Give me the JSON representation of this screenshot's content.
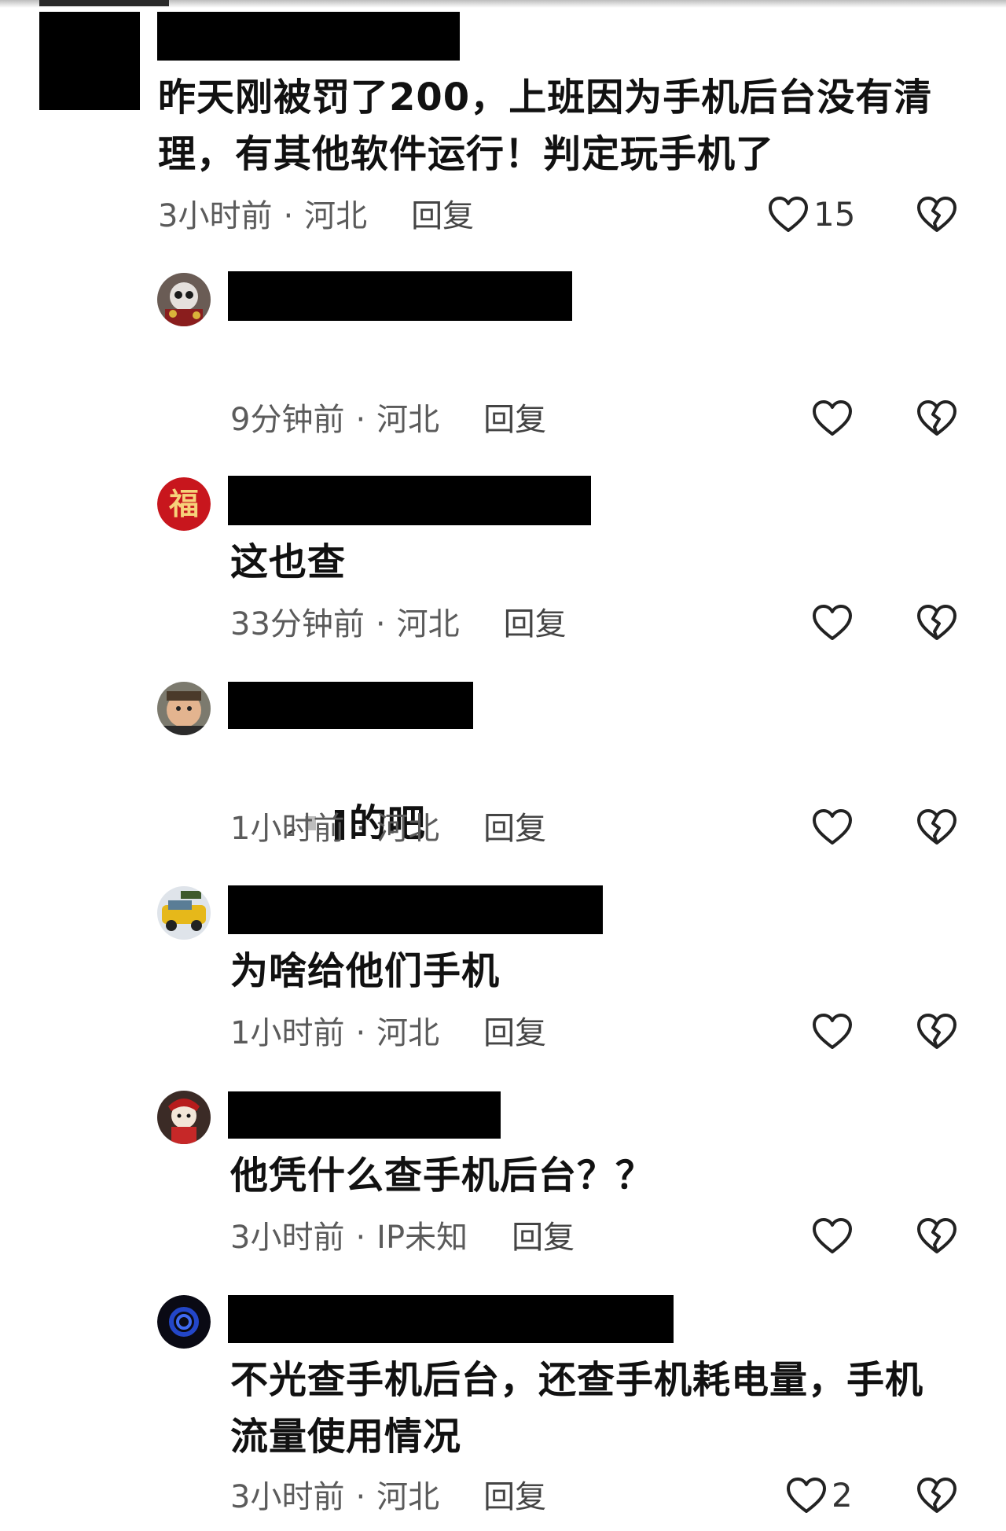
{
  "comments": [
    {
      "text": "昨天刚被罚了200，上班因为手机后台没有清\n理，有其他软件运行！判定玩手机了",
      "time": "3小时前",
      "location": "河北",
      "reply": "回复",
      "likes": "15"
    },
    {
      "text": "",
      "time": "9分钟前",
      "location": "河北",
      "reply": "回复",
      "likes": ""
    },
    {
      "text": "这也查",
      "time": "33分钟前",
      "location": "河北",
      "reply": "回复",
      "likes": ""
    },
    {
      "text": "的吧",
      "time": "1小时前",
      "location": "河北",
      "reply": "回复",
      "likes": ""
    },
    {
      "text": "为啥给他们手机",
      "time": "1小时前",
      "location": "河北",
      "reply": "回复",
      "likes": ""
    },
    {
      "text": "他凭什么查手机后台？？",
      "time": "3小时前",
      "location": "IP未知",
      "reply": "回复",
      "likes": ""
    },
    {
      "text": "不光查手机后台，还查手机耗电量，手机\n流量使用情况",
      "time": "3小时前",
      "location": "河北",
      "reply": "回复",
      "likes": "2"
    }
  ],
  "separator": "·",
  "icons": {
    "like": "heart-outline-icon",
    "dislike": "broken-heart-icon"
  },
  "avatars": {
    "fu_char": "福"
  },
  "colors": {
    "text": "#111111",
    "meta": "#5b5b5b",
    "redaction": "#000000",
    "fu_avatar": "#c8161d",
    "fu_char": "#f6d27a"
  }
}
